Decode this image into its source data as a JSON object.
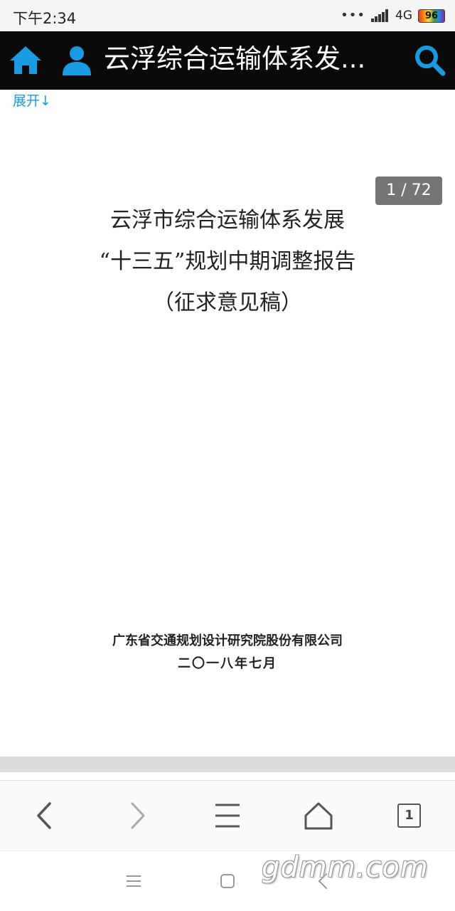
{
  "status_bar": {
    "time": "下午2:34",
    "network": "4G",
    "battery": "96"
  },
  "header": {
    "title": "云浮综合运输体系发...",
    "home_icon": "home-icon",
    "user_icon": "user-icon",
    "search_icon": "search-icon",
    "accent_color": "#1a9ae0"
  },
  "expand_label": "展开↓",
  "document": {
    "page_counter": "1 / 72",
    "title_lines": [
      "云浮市综合运输体系发展",
      "“十三五”规划中期调整报告",
      "（征求意见稿）"
    ],
    "organization": "广东省交通规划设计研究院股份有限公司",
    "date": "二〇一八年七月"
  },
  "bottom_bar": {
    "tab_count": "1",
    "icons": [
      "back-icon",
      "forward-icon",
      "menu-icon",
      "home-icon",
      "tabs-icon"
    ]
  },
  "system_nav": {
    "icons": [
      "menu-icon",
      "home-square-icon",
      "back-icon"
    ]
  },
  "watermark": "gdmm.com"
}
